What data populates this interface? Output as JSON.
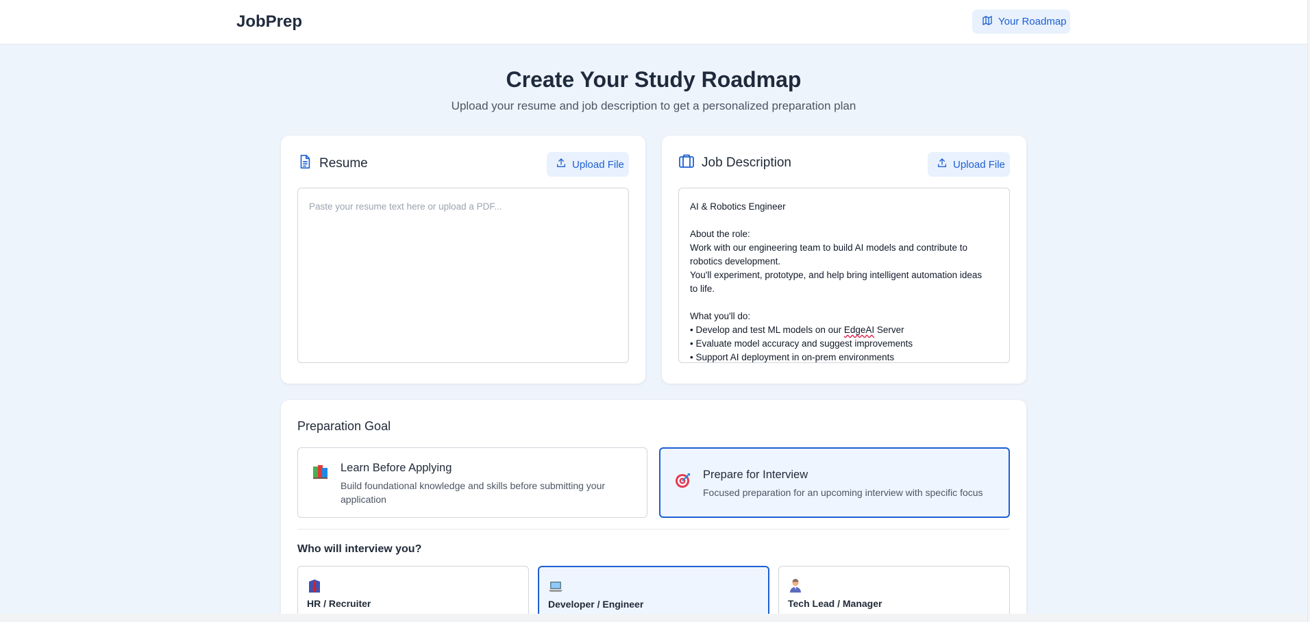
{
  "header": {
    "brand": "JobPrep",
    "roadmap_button": "Your Roadmap",
    "roadmap_icon": "map-icon"
  },
  "hero": {
    "title": "Create Your Study Roadmap",
    "subtitle": "Upload your resume and job description to get a personalized preparation plan"
  },
  "resume": {
    "title": "Resume",
    "icon": "document-icon",
    "upload_label": "Upload File",
    "placeholder": "Paste your resume text here or upload a PDF...",
    "value": ""
  },
  "job_description": {
    "title": "Job Description",
    "icon": "briefcase-icon",
    "upload_label": "Upload File",
    "lines": [
      "AI & Robotics Engineer",
      "",
      "About the role:",
      "Work with our engineering team to build AI models and contribute to",
      "robotics development.",
      "You'll experiment, prototype, and help bring intelligent automation ideas",
      "to life.",
      "",
      "What you'll do:",
      "• Develop and test ML models on our ",
      "EdgeAI",
      " Server",
      "• Evaluate model accuracy and suggest improvements",
      "• Support AI deployment in on-prem environments"
    ]
  },
  "goal": {
    "section_title": "Preparation Goal",
    "options": [
      {
        "title": "Learn Before Applying",
        "description": "Build foundational knowledge and skills before submitting your application",
        "icon": "books-icon",
        "selected": false
      },
      {
        "title": "Prepare for Interview",
        "description": "Focused preparation for an upcoming interview with specific focus",
        "icon": "target-icon",
        "selected": true
      }
    ]
  },
  "interviewer": {
    "section_title": "Who will interview you?",
    "options": [
      {
        "label": "HR / Recruiter",
        "icon": "necktie-icon",
        "selected": false
      },
      {
        "label": "Developer / Engineer",
        "icon": "laptop-icon",
        "selected": true
      },
      {
        "label": "Tech Lead / Manager",
        "icon": "manager-icon",
        "selected": false
      }
    ]
  },
  "colors": {
    "accent": "#1d5fd1",
    "page_background": "#eef4fb",
    "selected_background": "#eef5fe"
  }
}
